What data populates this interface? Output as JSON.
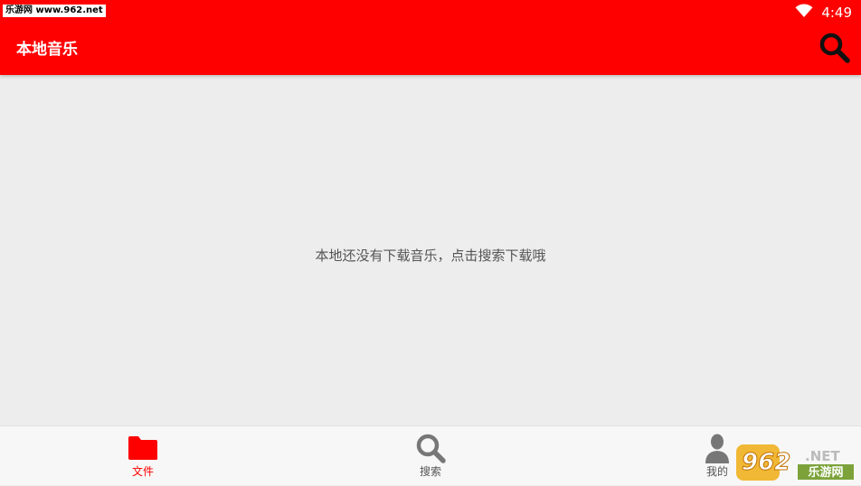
{
  "status_bar": {
    "watermark_text": "乐游网 www.962.net",
    "time": "4:49",
    "wifi_icon": "wifi-icon",
    "background": "#ff0000"
  },
  "app_bar": {
    "title": "本地音乐",
    "search_icon": "search-icon",
    "background": "#ff0000"
  },
  "main": {
    "empty_message": "本地还没有下载音乐，点击搜索下载哦"
  },
  "bottom_nav": {
    "items": [
      {
        "label": "文件",
        "icon": "folder-icon",
        "active": true,
        "color": "#ff0000"
      },
      {
        "label": "搜索",
        "icon": "search-icon",
        "active": false,
        "color": "#555555"
      },
      {
        "label": "我的",
        "icon": "user-icon",
        "active": false,
        "color": "#555555"
      }
    ]
  },
  "watermark_logo": {
    "top_text": "962.NET",
    "bottom_text": "乐游网"
  }
}
